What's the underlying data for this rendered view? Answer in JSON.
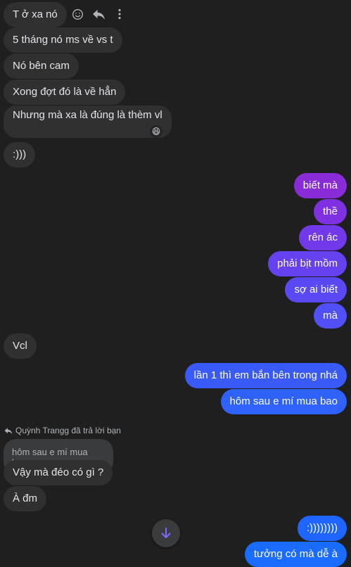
{
  "colors": {
    "background": "#1f1f1f",
    "incoming_bubble": "#303030",
    "outgoing_top": "#8a2be2",
    "outgoing_bottom": "#1a6bff",
    "quote_bubble": "#3a3b3c",
    "arrow_accent": "#6b5cff"
  },
  "icons": {
    "react": "smile-icon",
    "reply": "reply-icon",
    "more": "more-vertical-icon",
    "reply_label": "reply-small-icon",
    "scroll": "arrow-down-icon"
  },
  "messages": {
    "m1": "T ở xa nó",
    "m2": "5 tháng nó ms về vs t",
    "m3": "Nó bên cam",
    "m4": "Xong đợt đó là về hẳn",
    "m5": "Nhưng mà xa là đúng là thèm vl",
    "m5_reaction": "😆",
    "m6": ":)))",
    "o1": "biết mà",
    "o2": "thề",
    "o3": "rên ác",
    "o4": "phải bịt mồm",
    "o5": "sợ ai biết",
    "o6": "mà",
    "m7": "Vcl",
    "o7": "lần 1 thì em bắn bên trong nhá",
    "o8": "hôm sau e mí mua bao",
    "reply_header": "Quỳnh Trangg đã trả lời bạn",
    "quoted_text": "hôm sau e mí mua bao",
    "m8": "Vậy mà đéo có gì ?",
    "m9": "À đm",
    "o9": ":))))))))",
    "o10": "tưởng có mà dễ à"
  }
}
